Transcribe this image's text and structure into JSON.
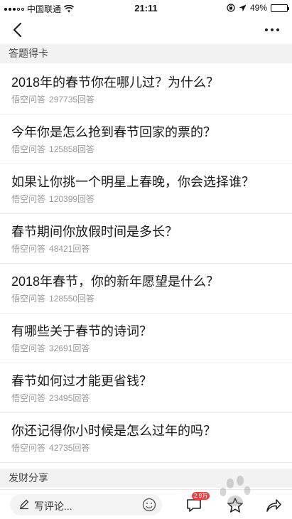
{
  "status_bar": {
    "carrier": "中国联通",
    "time": "21:11",
    "battery": "49%",
    "battery_level": 0.49
  },
  "section_1": {
    "title": "答题得卡"
  },
  "questions": [
    {
      "title": "2018年的春节你在哪儿过？为什么？",
      "source": "悟空问答",
      "answers": "297735回答"
    },
    {
      "title": "今年你是怎么抢到春节回家的票的？",
      "source": "悟空问答",
      "answers": "125858回答"
    },
    {
      "title": "如果让你挑一个明星上春晚，你会选择谁？",
      "source": "悟空问答",
      "answers": "120399回答"
    },
    {
      "title": "春节期间你放假时间是多长？",
      "source": "悟空问答",
      "answers": "48421回答"
    },
    {
      "title": "2018年春节，你的新年愿望是什么？",
      "source": "悟空问答",
      "answers": "128550回答"
    },
    {
      "title": "有哪些关于春节的诗词？",
      "source": "悟空问答",
      "answers": "32691回答"
    },
    {
      "title": "春节如何过才能更省钱？",
      "source": "悟空问答",
      "answers": "23495回答"
    },
    {
      "title": "你还记得你小时候是怎么过年的吗？",
      "source": "悟空问答",
      "answers": "42735回答"
    }
  ],
  "section_2": {
    "title": "发财分享"
  },
  "bottom_bar": {
    "comment_placeholder": "写评论...",
    "comment_badge": "2.9万"
  },
  "icons": {
    "back": "chevron-left-icon",
    "more": "more-dots-icon",
    "comment": "speech-bubble-icon",
    "favorite": "star-icon",
    "share": "share-arrow-icon",
    "emoji": "smiley-icon"
  },
  "colors": {
    "badge": "#f04142",
    "section_bg": "#f2f2f2",
    "meta_text": "#999999"
  }
}
